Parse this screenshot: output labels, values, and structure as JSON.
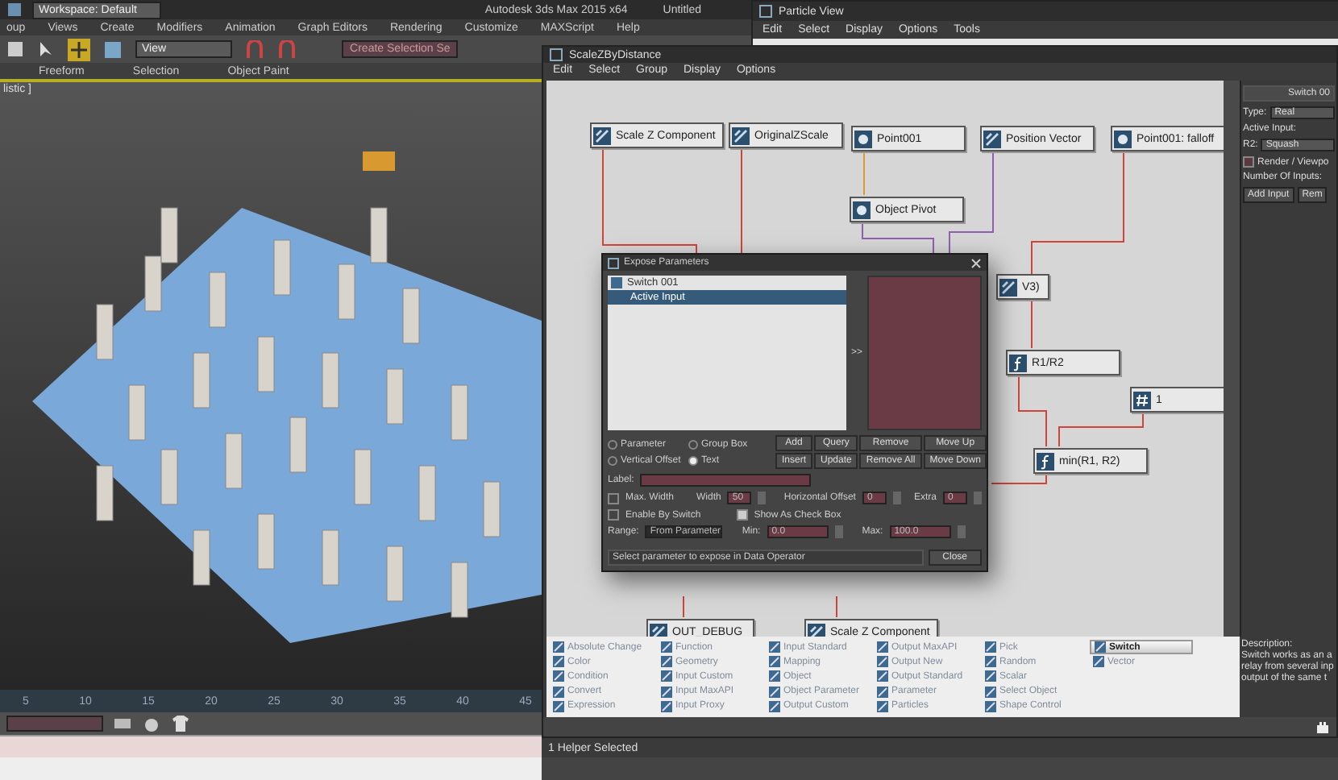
{
  "app": {
    "workspace": "Workspace: Default",
    "title": "Autodesk 3ds Max 2015 x64",
    "document": "Untitled",
    "menu": [
      "oup",
      "Views",
      "Create",
      "Modifiers",
      "Animation",
      "Graph Editors",
      "Rendering",
      "Customize",
      "MAXScript",
      "Help"
    ],
    "toolbar": {
      "view": "View",
      "selection_set": "Create Selection Se"
    },
    "ribbon_tabs": [
      "Freeform",
      "Selection",
      "Object Paint"
    ],
    "viewport_label": "listic ]",
    "timeline_ticks": [
      "5",
      "10",
      "15",
      "20",
      "25",
      "30",
      "35",
      "40",
      "45"
    ],
    "status": "1 Helper Selected"
  },
  "particle_view": {
    "title": "Particle View",
    "menu": [
      "Edit",
      "Select",
      "Display",
      "Options",
      "Tools"
    ]
  },
  "node_editor": {
    "title": "ScaleZByDistance",
    "menu": [
      "Edit",
      "Select",
      "Group",
      "Display",
      "Options"
    ],
    "nodes": [
      {
        "label": "Scale Z Component",
        "kind": "operator"
      },
      {
        "label": "OriginalZScale",
        "kind": "operator"
      },
      {
        "label": "Point001",
        "kind": "object"
      },
      {
        "label": "Position Vector",
        "kind": "operator"
      },
      {
        "label": "Point001: falloff",
        "kind": "object"
      },
      {
        "label": "Object Pivot",
        "kind": "object"
      },
      {
        "label": "V3)",
        "kind": "operator"
      },
      {
        "label": "R1/R2",
        "kind": "function"
      },
      {
        "label": "1",
        "kind": "constant"
      },
      {
        "label": "min(R1, R2)",
        "kind": "function"
      },
      {
        "label": "OUT_DEBUG",
        "kind": "operator"
      },
      {
        "label": "Scale Z Component",
        "kind": "operator"
      }
    ],
    "palette": [
      {
        "label": "Absolute Change",
        "selected": false
      },
      {
        "label": "Color",
        "selected": false
      },
      {
        "label": "Condition",
        "selected": false
      },
      {
        "label": "Convert",
        "selected": false
      },
      {
        "label": "Expression",
        "selected": false
      },
      {
        "label": "Function",
        "selected": false
      },
      {
        "label": "Geometry",
        "selected": false
      },
      {
        "label": "Input Custom",
        "selected": false
      },
      {
        "label": "Input MaxAPI",
        "selected": false
      },
      {
        "label": "Input Proxy",
        "selected": false
      },
      {
        "label": "Input Standard",
        "selected": false
      },
      {
        "label": "Mapping",
        "selected": false
      },
      {
        "label": "Object",
        "selected": false
      },
      {
        "label": "Object Parameter",
        "selected": false
      },
      {
        "label": "Output Custom",
        "selected": false
      },
      {
        "label": "Output MaxAPI",
        "selected": false
      },
      {
        "label": "Output New",
        "selected": false
      },
      {
        "label": "Output Standard",
        "selected": false
      },
      {
        "label": "Parameter",
        "selected": false
      },
      {
        "label": "Particles",
        "selected": false
      },
      {
        "label": "Pick",
        "selected": false
      },
      {
        "label": "Random",
        "selected": false
      },
      {
        "label": "Scalar",
        "selected": false
      },
      {
        "label": "Select Object",
        "selected": false
      },
      {
        "label": "Shape Control",
        "selected": false
      },
      {
        "label": "Switch",
        "selected": true
      },
      {
        "label": "Vector",
        "selected": false
      }
    ],
    "rollout": {
      "title": "Switch 00",
      "type_label": "Type:",
      "type": "Real",
      "active_input_label": "Active Input:",
      "input_label": "R2:",
      "input_value": "Squash",
      "render_viewport": {
        "label": "Render / Viewpo",
        "checked": false
      },
      "inputs_label": "Number Of Inputs:",
      "buttons": [
        "Add Input",
        "Rem"
      ]
    },
    "description": {
      "title": "Description:",
      "lines": [
        "Switch works as an a",
        "relay from several inp",
        "output of the same t"
      ]
    }
  },
  "expose_dialog": {
    "title": "Expose Parameters",
    "tree": [
      {
        "label": "Switch 001",
        "selected": false,
        "children": [
          {
            "label": "Active Input",
            "selected": true
          }
        ]
      }
    ],
    "move_button": ">>",
    "options": [
      {
        "label": "Parameter",
        "selected": false
      },
      {
        "label": "Group Box",
        "selected": false
      },
      {
        "label": "Vertical Offset",
        "selected": false
      },
      {
        "label": "Text",
        "selected": true
      }
    ],
    "buttons": [
      "Add",
      "Query",
      "Remove",
      "Move Up",
      "Insert",
      "Update",
      "Remove All",
      "Move Down"
    ],
    "label_field": "Label:",
    "max_width": {
      "label": "Max. Width",
      "checked": false
    },
    "width": {
      "label": "Width",
      "value": "50"
    },
    "horizontal_offset": {
      "label": "Horizontal Offset",
      "value": "0"
    },
    "extra": {
      "label": "Extra",
      "value": "0"
    },
    "enable_by_switch": {
      "label": "Enable By Switch",
      "checked": false
    },
    "show_as_check_box": {
      "label": "Show As Check Box",
      "checked": true
    },
    "range": {
      "label": "Range:",
      "value": "From Parameter"
    },
    "min": {
      "label": "Min:",
      "value": "0.0"
    },
    "max": {
      "label": "Max:",
      "value": "100.0"
    },
    "status": "Select parameter to expose in Data Operator",
    "close": "Close"
  }
}
